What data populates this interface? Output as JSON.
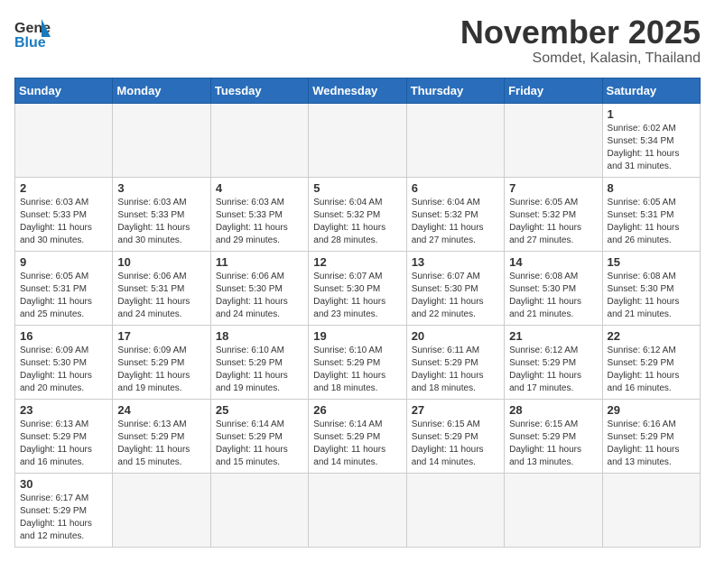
{
  "header": {
    "logo_general": "General",
    "logo_blue": "Blue",
    "month": "November 2025",
    "location": "Somdet, Kalasin, Thailand"
  },
  "days_of_week": [
    "Sunday",
    "Monday",
    "Tuesday",
    "Wednesday",
    "Thursday",
    "Friday",
    "Saturday"
  ],
  "weeks": [
    [
      {
        "day": "",
        "info": ""
      },
      {
        "day": "",
        "info": ""
      },
      {
        "day": "",
        "info": ""
      },
      {
        "day": "",
        "info": ""
      },
      {
        "day": "",
        "info": ""
      },
      {
        "day": "",
        "info": ""
      },
      {
        "day": "1",
        "info": "Sunrise: 6:02 AM\nSunset: 5:34 PM\nDaylight: 11 hours\nand 31 minutes."
      }
    ],
    [
      {
        "day": "2",
        "info": "Sunrise: 6:03 AM\nSunset: 5:33 PM\nDaylight: 11 hours\nand 30 minutes."
      },
      {
        "day": "3",
        "info": "Sunrise: 6:03 AM\nSunset: 5:33 PM\nDaylight: 11 hours\nand 30 minutes."
      },
      {
        "day": "4",
        "info": "Sunrise: 6:03 AM\nSunset: 5:33 PM\nDaylight: 11 hours\nand 29 minutes."
      },
      {
        "day": "5",
        "info": "Sunrise: 6:04 AM\nSunset: 5:32 PM\nDaylight: 11 hours\nand 28 minutes."
      },
      {
        "day": "6",
        "info": "Sunrise: 6:04 AM\nSunset: 5:32 PM\nDaylight: 11 hours\nand 27 minutes."
      },
      {
        "day": "7",
        "info": "Sunrise: 6:05 AM\nSunset: 5:32 PM\nDaylight: 11 hours\nand 27 minutes."
      },
      {
        "day": "8",
        "info": "Sunrise: 6:05 AM\nSunset: 5:31 PM\nDaylight: 11 hours\nand 26 minutes."
      }
    ],
    [
      {
        "day": "9",
        "info": "Sunrise: 6:05 AM\nSunset: 5:31 PM\nDaylight: 11 hours\nand 25 minutes."
      },
      {
        "day": "10",
        "info": "Sunrise: 6:06 AM\nSunset: 5:31 PM\nDaylight: 11 hours\nand 24 minutes."
      },
      {
        "day": "11",
        "info": "Sunrise: 6:06 AM\nSunset: 5:30 PM\nDaylight: 11 hours\nand 24 minutes."
      },
      {
        "day": "12",
        "info": "Sunrise: 6:07 AM\nSunset: 5:30 PM\nDaylight: 11 hours\nand 23 minutes."
      },
      {
        "day": "13",
        "info": "Sunrise: 6:07 AM\nSunset: 5:30 PM\nDaylight: 11 hours\nand 22 minutes."
      },
      {
        "day": "14",
        "info": "Sunrise: 6:08 AM\nSunset: 5:30 PM\nDaylight: 11 hours\nand 21 minutes."
      },
      {
        "day": "15",
        "info": "Sunrise: 6:08 AM\nSunset: 5:30 PM\nDaylight: 11 hours\nand 21 minutes."
      }
    ],
    [
      {
        "day": "16",
        "info": "Sunrise: 6:09 AM\nSunset: 5:30 PM\nDaylight: 11 hours\nand 20 minutes."
      },
      {
        "day": "17",
        "info": "Sunrise: 6:09 AM\nSunset: 5:29 PM\nDaylight: 11 hours\nand 19 minutes."
      },
      {
        "day": "18",
        "info": "Sunrise: 6:10 AM\nSunset: 5:29 PM\nDaylight: 11 hours\nand 19 minutes."
      },
      {
        "day": "19",
        "info": "Sunrise: 6:10 AM\nSunset: 5:29 PM\nDaylight: 11 hours\nand 18 minutes."
      },
      {
        "day": "20",
        "info": "Sunrise: 6:11 AM\nSunset: 5:29 PM\nDaylight: 11 hours\nand 18 minutes."
      },
      {
        "day": "21",
        "info": "Sunrise: 6:12 AM\nSunset: 5:29 PM\nDaylight: 11 hours\nand 17 minutes."
      },
      {
        "day": "22",
        "info": "Sunrise: 6:12 AM\nSunset: 5:29 PM\nDaylight: 11 hours\nand 16 minutes."
      }
    ],
    [
      {
        "day": "23",
        "info": "Sunrise: 6:13 AM\nSunset: 5:29 PM\nDaylight: 11 hours\nand 16 minutes."
      },
      {
        "day": "24",
        "info": "Sunrise: 6:13 AM\nSunset: 5:29 PM\nDaylight: 11 hours\nand 15 minutes."
      },
      {
        "day": "25",
        "info": "Sunrise: 6:14 AM\nSunset: 5:29 PM\nDaylight: 11 hours\nand 15 minutes."
      },
      {
        "day": "26",
        "info": "Sunrise: 6:14 AM\nSunset: 5:29 PM\nDaylight: 11 hours\nand 14 minutes."
      },
      {
        "day": "27",
        "info": "Sunrise: 6:15 AM\nSunset: 5:29 PM\nDaylight: 11 hours\nand 14 minutes."
      },
      {
        "day": "28",
        "info": "Sunrise: 6:15 AM\nSunset: 5:29 PM\nDaylight: 11 hours\nand 13 minutes."
      },
      {
        "day": "29",
        "info": "Sunrise: 6:16 AM\nSunset: 5:29 PM\nDaylight: 11 hours\nand 13 minutes."
      }
    ],
    [
      {
        "day": "30",
        "info": "Sunrise: 6:17 AM\nSunset: 5:29 PM\nDaylight: 11 hours\nand 12 minutes."
      },
      {
        "day": "",
        "info": ""
      },
      {
        "day": "",
        "info": ""
      },
      {
        "day": "",
        "info": ""
      },
      {
        "day": "",
        "info": ""
      },
      {
        "day": "",
        "info": ""
      },
      {
        "day": "",
        "info": ""
      }
    ]
  ]
}
